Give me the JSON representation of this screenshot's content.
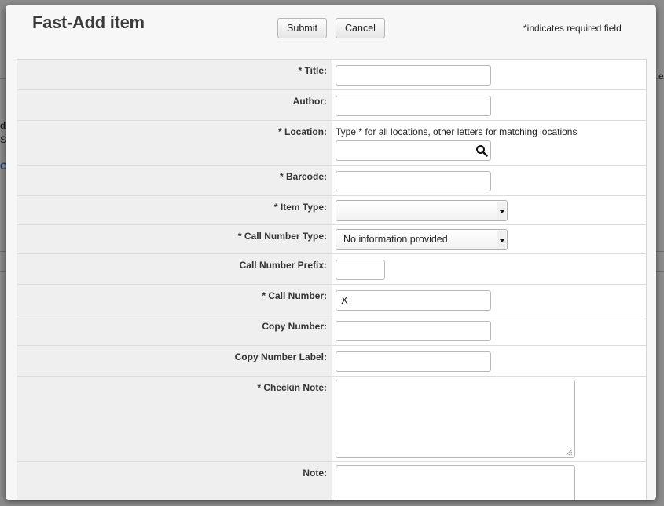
{
  "modal": {
    "title": "Fast-Add item",
    "submit_label": "Submit",
    "cancel_label": "Cancel",
    "required_note": "*indicates required field"
  },
  "background": {
    "left_char_1": "d",
    "left_char_2": "S",
    "left_link": "C",
    "right_fragment": "e"
  },
  "fields": {
    "title": {
      "label": "* Title:",
      "value": ""
    },
    "author": {
      "label": "Author:",
      "value": ""
    },
    "location": {
      "label": "* Location:",
      "hint": "Type * for all locations, other letters for matching locations",
      "value": ""
    },
    "barcode": {
      "label": "* Barcode:",
      "value": ""
    },
    "item_type": {
      "label": "* Item Type:",
      "selected": ""
    },
    "call_number_type": {
      "label": "* Call Number Type:",
      "selected": "No information provided"
    },
    "call_number_prefix": {
      "label": "Call Number Prefix:",
      "value": ""
    },
    "call_number": {
      "label": "* Call Number:",
      "value": "X"
    },
    "copy_number": {
      "label": "Copy Number:",
      "value": ""
    },
    "copy_number_label": {
      "label": "Copy Number Label:",
      "value": ""
    },
    "checkin_note": {
      "label": "* Checkin Note:",
      "value": ""
    },
    "note": {
      "label": "Note:",
      "value": ""
    }
  },
  "icons": {
    "location_search": "search-icon",
    "resize": "resize-grip-icon"
  },
  "colors": {
    "label_bg": "#efefef",
    "modal_bg": "#f7f7f7",
    "overlay": "#8a8a8a"
  }
}
